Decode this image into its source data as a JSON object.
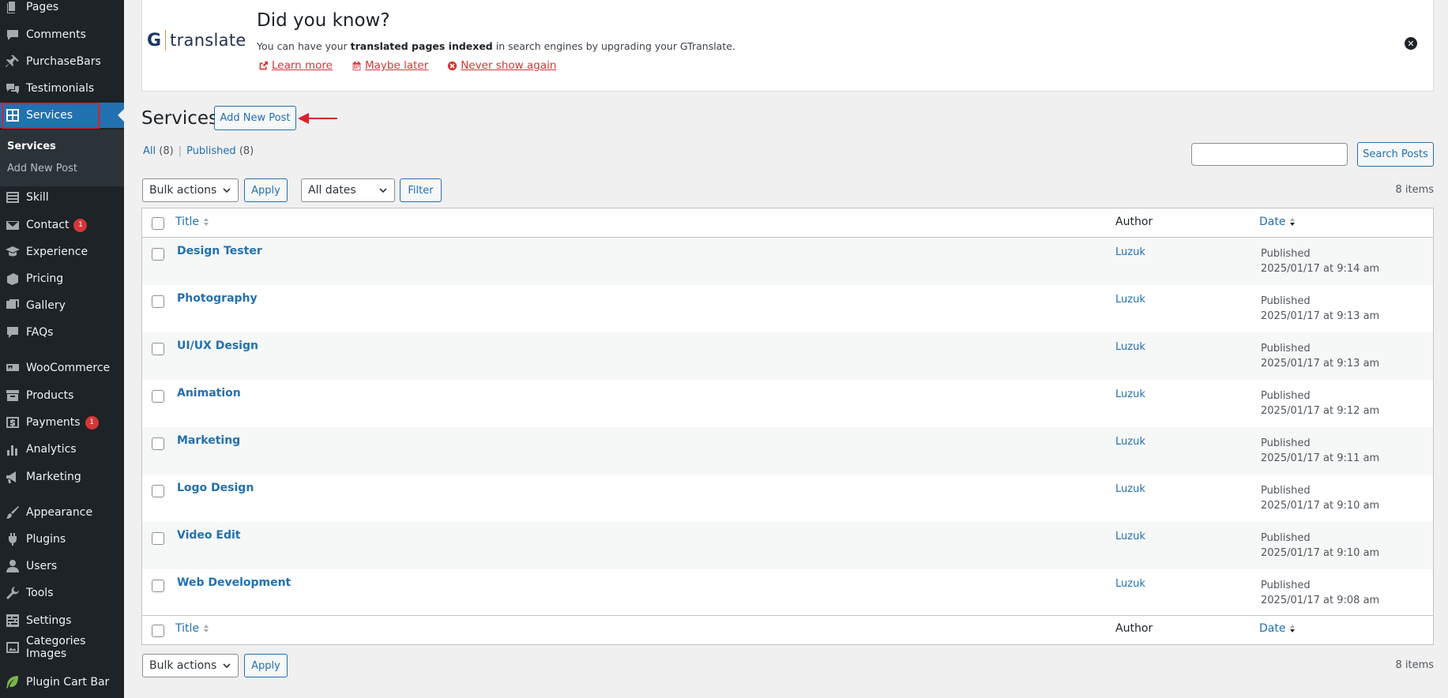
{
  "sidebar": {
    "items": [
      {
        "label": "Pages",
        "icon": "pages-icon"
      },
      {
        "label": "Comments",
        "icon": "comments-icon"
      },
      {
        "label": "PurchaseBars",
        "icon": "pin-icon"
      },
      {
        "label": "Testimonials",
        "icon": "testimonials-icon"
      },
      {
        "label": "Services",
        "icon": "grid-icon",
        "active": true
      },
      {
        "label": "Skill",
        "icon": "list-icon"
      },
      {
        "label": "Contact",
        "icon": "mail-icon",
        "badge": "1"
      },
      {
        "label": "Experience",
        "icon": "graduation-icon"
      },
      {
        "label": "Pricing",
        "icon": "pricing-icon"
      },
      {
        "label": "Gallery",
        "icon": "gallery-icon"
      },
      {
        "label": "FAQs",
        "icon": "faq-icon"
      },
      {
        "label": "WooCommerce",
        "icon": "woo-icon"
      },
      {
        "label": "Products",
        "icon": "archive-icon"
      },
      {
        "label": "Payments",
        "icon": "dollar-icon",
        "badge": "1"
      },
      {
        "label": "Analytics",
        "icon": "bar-chart-icon"
      },
      {
        "label": "Marketing",
        "icon": "megaphone-icon"
      },
      {
        "label": "Appearance",
        "icon": "brush-icon"
      },
      {
        "label": "Plugins",
        "icon": "plug-icon"
      },
      {
        "label": "Users",
        "icon": "user-icon"
      },
      {
        "label": "Tools",
        "icon": "wrench-icon"
      },
      {
        "label": "Settings",
        "icon": "settings-icon"
      },
      {
        "label": "Categories Images",
        "icon": "image-icon"
      },
      {
        "label": "Plugin Cart Bar",
        "icon": "leaf-icon"
      }
    ],
    "submenu": {
      "current": "Services",
      "add_new": "Add New Post"
    }
  },
  "notice": {
    "logo_g": "G",
    "logo_text": "translate",
    "title": "Did you know?",
    "text_before": "You can have your ",
    "text_bold": "translated pages indexed",
    "text_after": " in search engines by upgrading your GTranslate.",
    "link_learn": "Learn more",
    "link_later": "Maybe later",
    "link_never": "Never show again"
  },
  "header": {
    "title": "Services",
    "add_new": "Add New Post"
  },
  "filters": {
    "all_label": "All",
    "all_count": "(8)",
    "published_label": "Published",
    "published_count": "(8)",
    "search_button": "Search Posts",
    "bulk_actions": "Bulk actions",
    "apply": "Apply",
    "all_dates": "All dates",
    "filter": "Filter",
    "items_count": "8 items"
  },
  "table": {
    "columns": {
      "title": "Title",
      "author": "Author",
      "date": "Date"
    },
    "rows": [
      {
        "title": "Design Tester",
        "author": "Luzuk",
        "status": "Published",
        "date": "2025/01/17 at 9:14 am"
      },
      {
        "title": "Photography",
        "author": "Luzuk",
        "status": "Published",
        "date": "2025/01/17 at 9:13 am"
      },
      {
        "title": "UI/UX Design",
        "author": "Luzuk",
        "status": "Published",
        "date": "2025/01/17 at 9:13 am"
      },
      {
        "title": "Animation",
        "author": "Luzuk",
        "status": "Published",
        "date": "2025/01/17 at 9:12 am"
      },
      {
        "title": "Marketing",
        "author": "Luzuk",
        "status": "Published",
        "date": "2025/01/17 at 9:11 am"
      },
      {
        "title": "Logo Design",
        "author": "Luzuk",
        "status": "Published",
        "date": "2025/01/17 at 9:10 am"
      },
      {
        "title": "Video Edit",
        "author": "Luzuk",
        "status": "Published",
        "date": "2025/01/17 at 9:10 am"
      },
      {
        "title": "Web Development",
        "author": "Luzuk",
        "status": "Published",
        "date": "2025/01/17 at 9:08 am"
      }
    ]
  },
  "colors": {
    "accent": "#2271b1",
    "sidebar_bg": "#1d2327",
    "notice_link": "#d63638",
    "annotation": "#e11d2b"
  }
}
